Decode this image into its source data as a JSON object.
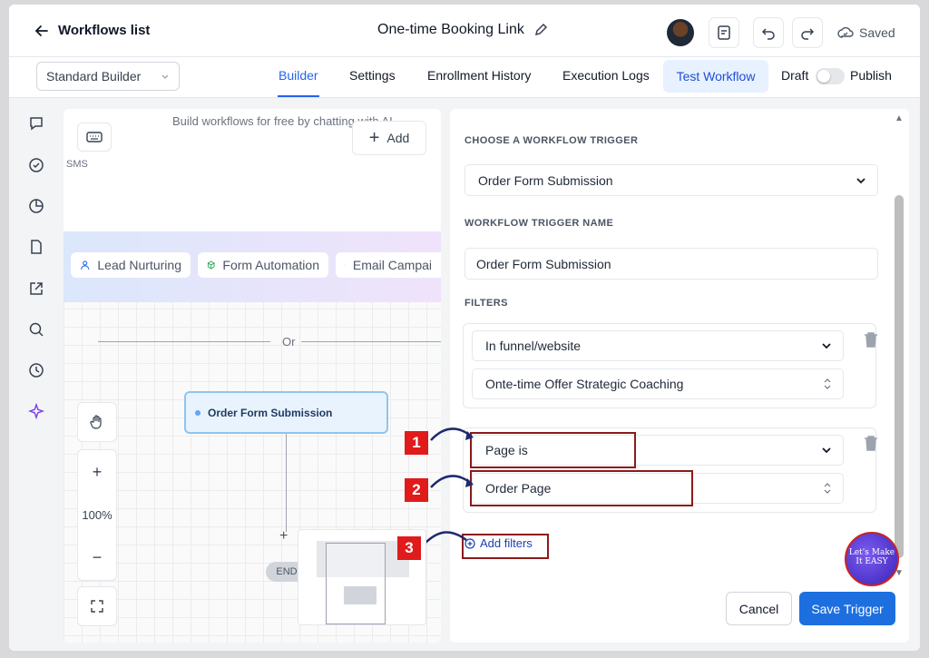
{
  "header": {
    "back_label": "Workflows list",
    "title": "One-time Booking Link",
    "saved_label": "Saved"
  },
  "subbar": {
    "builder_select": "Standard Builder",
    "tabs": [
      "Builder",
      "Settings",
      "Enrollment History",
      "Execution Logs",
      "Test Workflow"
    ],
    "active_tab": "Builder",
    "draft_label": "Draft",
    "publish_label": "Publish"
  },
  "canvas": {
    "ai_prompt": "Build workflows for free by chatting with AI",
    "sms_label": "SMS",
    "add_label": "Add",
    "chips": [
      "Lead Nurturing",
      "Form Automation",
      "Email Campai"
    ],
    "or_label": "Or",
    "trigger_node": "Order Form Submission",
    "zoom": "100%",
    "plus": "+",
    "minus": "−",
    "end_label": "END"
  },
  "panel": {
    "choose_trigger_label": "CHOOSE A WORKFLOW TRIGGER",
    "trigger_value": "Order Form Submission",
    "trigger_name_label": "WORKFLOW TRIGGER NAME",
    "trigger_name_value": "Order Form Submission",
    "filters_label": "FILTERS",
    "filter1_type": "In funnel/website",
    "filter1_value": "Onte-time Offer Strategic Coaching",
    "filter2_type": "Page is",
    "filter2_value": "Order Page",
    "add_filters": "Add filters",
    "cancel": "Cancel",
    "save": "Save Trigger"
  },
  "annotations": {
    "n1": "1",
    "n2": "2",
    "n3": "3",
    "badge": "Let's Make It EASY"
  },
  "colors": {
    "accent": "#1d6fe0",
    "annotation_red": "#e01b1b",
    "node_fill": "#e9f3fd"
  }
}
